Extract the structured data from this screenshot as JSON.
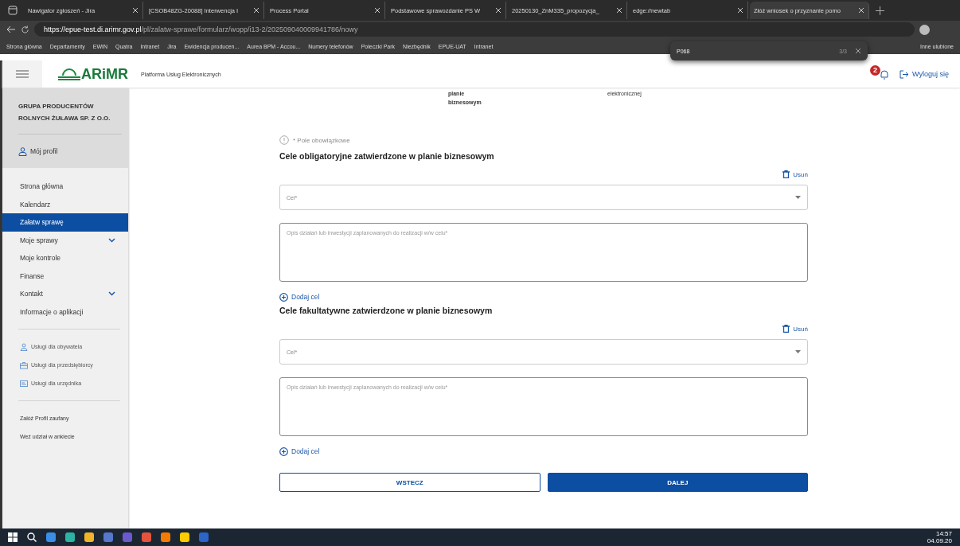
{
  "browser": {
    "tabs": [
      {
        "title": "Nawigator zgłoszeń - Jira",
        "selected": false
      },
      {
        "title": "[CSOB48ZG-20088] Interwencja I",
        "selected": false
      },
      {
        "title": "Process Portal",
        "selected": false
      },
      {
        "title": "Podstawowe sprawozdanie PS W",
        "selected": false
      },
      {
        "title": "20250130_ZnM335_propozycja_",
        "selected": false
      },
      {
        "title": "edge://newtab",
        "selected": false
      },
      {
        "title": "Złóż wniosek o przyznanie pomo",
        "selected": true
      }
    ],
    "url_host": "https://epue-test.di.arimr.gov.pl",
    "url_path": "/pl/zalatw-sprawe/formularz/wopp/i13-2/202509040009941786/nowy",
    "bookmarks": [
      {
        "label": "Strona główna"
      },
      {
        "label": "Departamenty"
      },
      {
        "label": "EWIN"
      },
      {
        "label": "Quatra"
      },
      {
        "label": "Intranet"
      },
      {
        "label": "Jira"
      },
      {
        "label": "Ewidencja producen..."
      },
      {
        "label": "Aurea BPM - Accou..."
      },
      {
        "label": "Numery telefonów"
      },
      {
        "label": "Poleczki Park"
      },
      {
        "label": "Niezbędnik"
      },
      {
        "label": "EPUE-UAT"
      },
      {
        "label": "Intranet"
      }
    ],
    "other_bookmarks": "Inne ulubione",
    "find_bar": {
      "query": "P068",
      "count": "3/3"
    }
  },
  "header": {
    "logo": "ARiMR",
    "platform_title": "Platforma Usług Elektronicznych",
    "notifications": "2",
    "logout": "Wyloguj się"
  },
  "sidebar": {
    "org_name": "GRUPA PRODUCENTÓW ROLNYCH ŻUŁAWA SP. Z O.O.",
    "profile": "Mój profil",
    "nav": [
      {
        "label": "Strona główna",
        "selected": false,
        "expandable": false
      },
      {
        "label": "Kalendarz",
        "selected": false,
        "expandable": false
      },
      {
        "label": "Załatw sprawę",
        "selected": true,
        "expandable": false
      },
      {
        "label": "Moje sprawy",
        "selected": false,
        "expandable": true
      },
      {
        "label": "Moje kontrole",
        "selected": false,
        "expandable": false
      },
      {
        "label": "Finanse",
        "selected": false,
        "expandable": false
      },
      {
        "label": "Kontakt",
        "selected": false,
        "expandable": true
      },
      {
        "label": "Informacje o aplikacji",
        "selected": false,
        "expandable": false
      }
    ],
    "services": [
      {
        "label": "Usługi dla obywatela",
        "kind": "citizen"
      },
      {
        "label": "Usługi dla przedsiębiorcy",
        "kind": "business"
      },
      {
        "label": "Usługi dla urzędnika",
        "kind": "official"
      }
    ],
    "links": [
      "Załóż Profil zaufany",
      "Weź udział w ankiecie"
    ]
  },
  "form": {
    "steps_cut": [
      {
        "lines": [
          "planie",
          "biznesowym"
        ],
        "bold": true
      },
      {
        "lines": [
          "elektronicznej"
        ],
        "bold": false
      }
    ],
    "required_note": "* Pole obowiązkowe",
    "sections": [
      {
        "title": "Cele obligatoryjne zatwierdzone w planie biznesowym",
        "remove": "Usuń",
        "select_placeholder": "Cel*",
        "textarea_placeholder": "Opis działań lub inwestycji zaplanowanych do realizacji w/w celu*",
        "add": "Dodaj cel"
      },
      {
        "title": "Cele fakultatywne zatwierdzone w planie biznesowym",
        "remove": "Usuń",
        "select_placeholder": "Cel*",
        "textarea_placeholder": "Opis działań lub inwestycji zaplanowanych do realizacji w/w celu*",
        "add": "Dodaj cel"
      }
    ],
    "back": "WSTECZ",
    "next": "DALEJ"
  },
  "taskbar": {
    "time": "14:57",
    "date": "04.09.20"
  }
}
